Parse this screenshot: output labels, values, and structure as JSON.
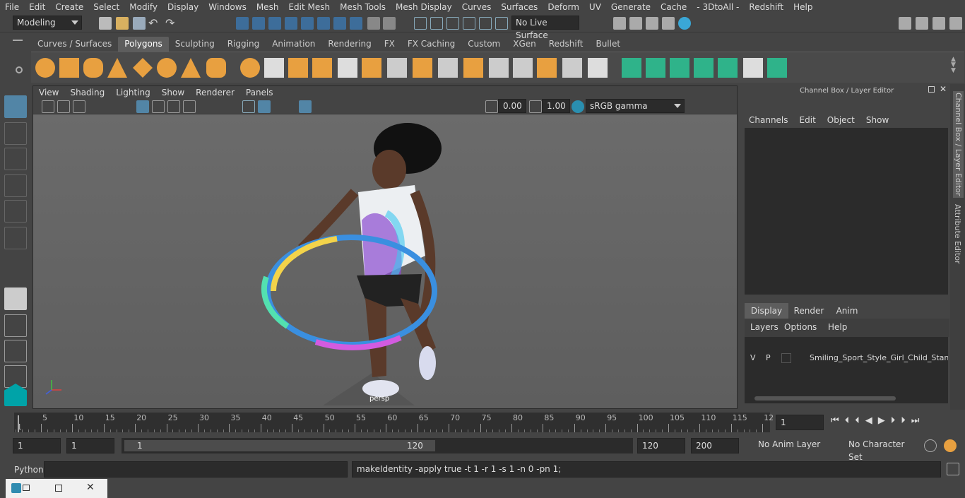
{
  "menubar": {
    "items": [
      "File",
      "Edit",
      "Create",
      "Select",
      "Modify",
      "Display",
      "Windows",
      "Mesh",
      "Edit Mesh",
      "Mesh Tools",
      "Mesh Display",
      "Curves",
      "Surfaces",
      "Deform",
      "UV",
      "Generate",
      "Cache",
      "- 3DtoAll -",
      "Redshift",
      "Help"
    ]
  },
  "status": {
    "mode": "Modeling",
    "live_surface": "No Live Surface"
  },
  "shelf": {
    "tabs": [
      "Curves / Surfaces",
      "Polygons",
      "Sculpting",
      "Rigging",
      "Animation",
      "Rendering",
      "FX",
      "FX Caching",
      "Custom",
      "XGen",
      "Redshift",
      "Bullet"
    ],
    "active_tab": "Polygons"
  },
  "viewport": {
    "menu": [
      "View",
      "Shading",
      "Lighting",
      "Show",
      "Renderer",
      "Panels"
    ],
    "exposure": "0.00",
    "gamma": "1.00",
    "colorspace": "sRGB gamma",
    "camera_label": "persp"
  },
  "channel_box": {
    "title": "Channel Box / Layer Editor",
    "menu": [
      "Channels",
      "Edit",
      "Object",
      "Show"
    ],
    "layer_tabs": [
      "Display",
      "Render",
      "Anim"
    ],
    "active_layer_tab": "Display",
    "layer_menu": [
      "Layers",
      "Options",
      "Help"
    ],
    "layer": {
      "v": "V",
      "p": "P",
      "name": "Smiling_Sport_Style_Girl_Child_Standi"
    }
  },
  "side_tabs": {
    "channel": "Channel Box / Layer Editor",
    "attribute": "Attribute Editor"
  },
  "timeline": {
    "ticks": [
      "5",
      "10",
      "15",
      "20",
      "25",
      "30",
      "35",
      "40",
      "45",
      "50",
      "55",
      "60",
      "65",
      "70",
      "75",
      "80",
      "85",
      "90",
      "95",
      "100",
      "105",
      "110",
      "115",
      "12"
    ],
    "start_mark": "1",
    "current_frame": "1"
  },
  "range": {
    "start": "1",
    "playback_start": "1",
    "slider_start": "1",
    "slider_end": "120",
    "playback_end": "120",
    "end": "200",
    "anim_layer": "No Anim Layer",
    "character_set": "No Character Set"
  },
  "command": {
    "language": "Python",
    "output": "makeIdentity -apply true -t 1 -r 1 -s 1 -n 0 -pn 1;"
  },
  "colors": {
    "accent": "#5285a6",
    "shelf_orange": "#e8a040",
    "shelf_green": "#2fb38a"
  }
}
